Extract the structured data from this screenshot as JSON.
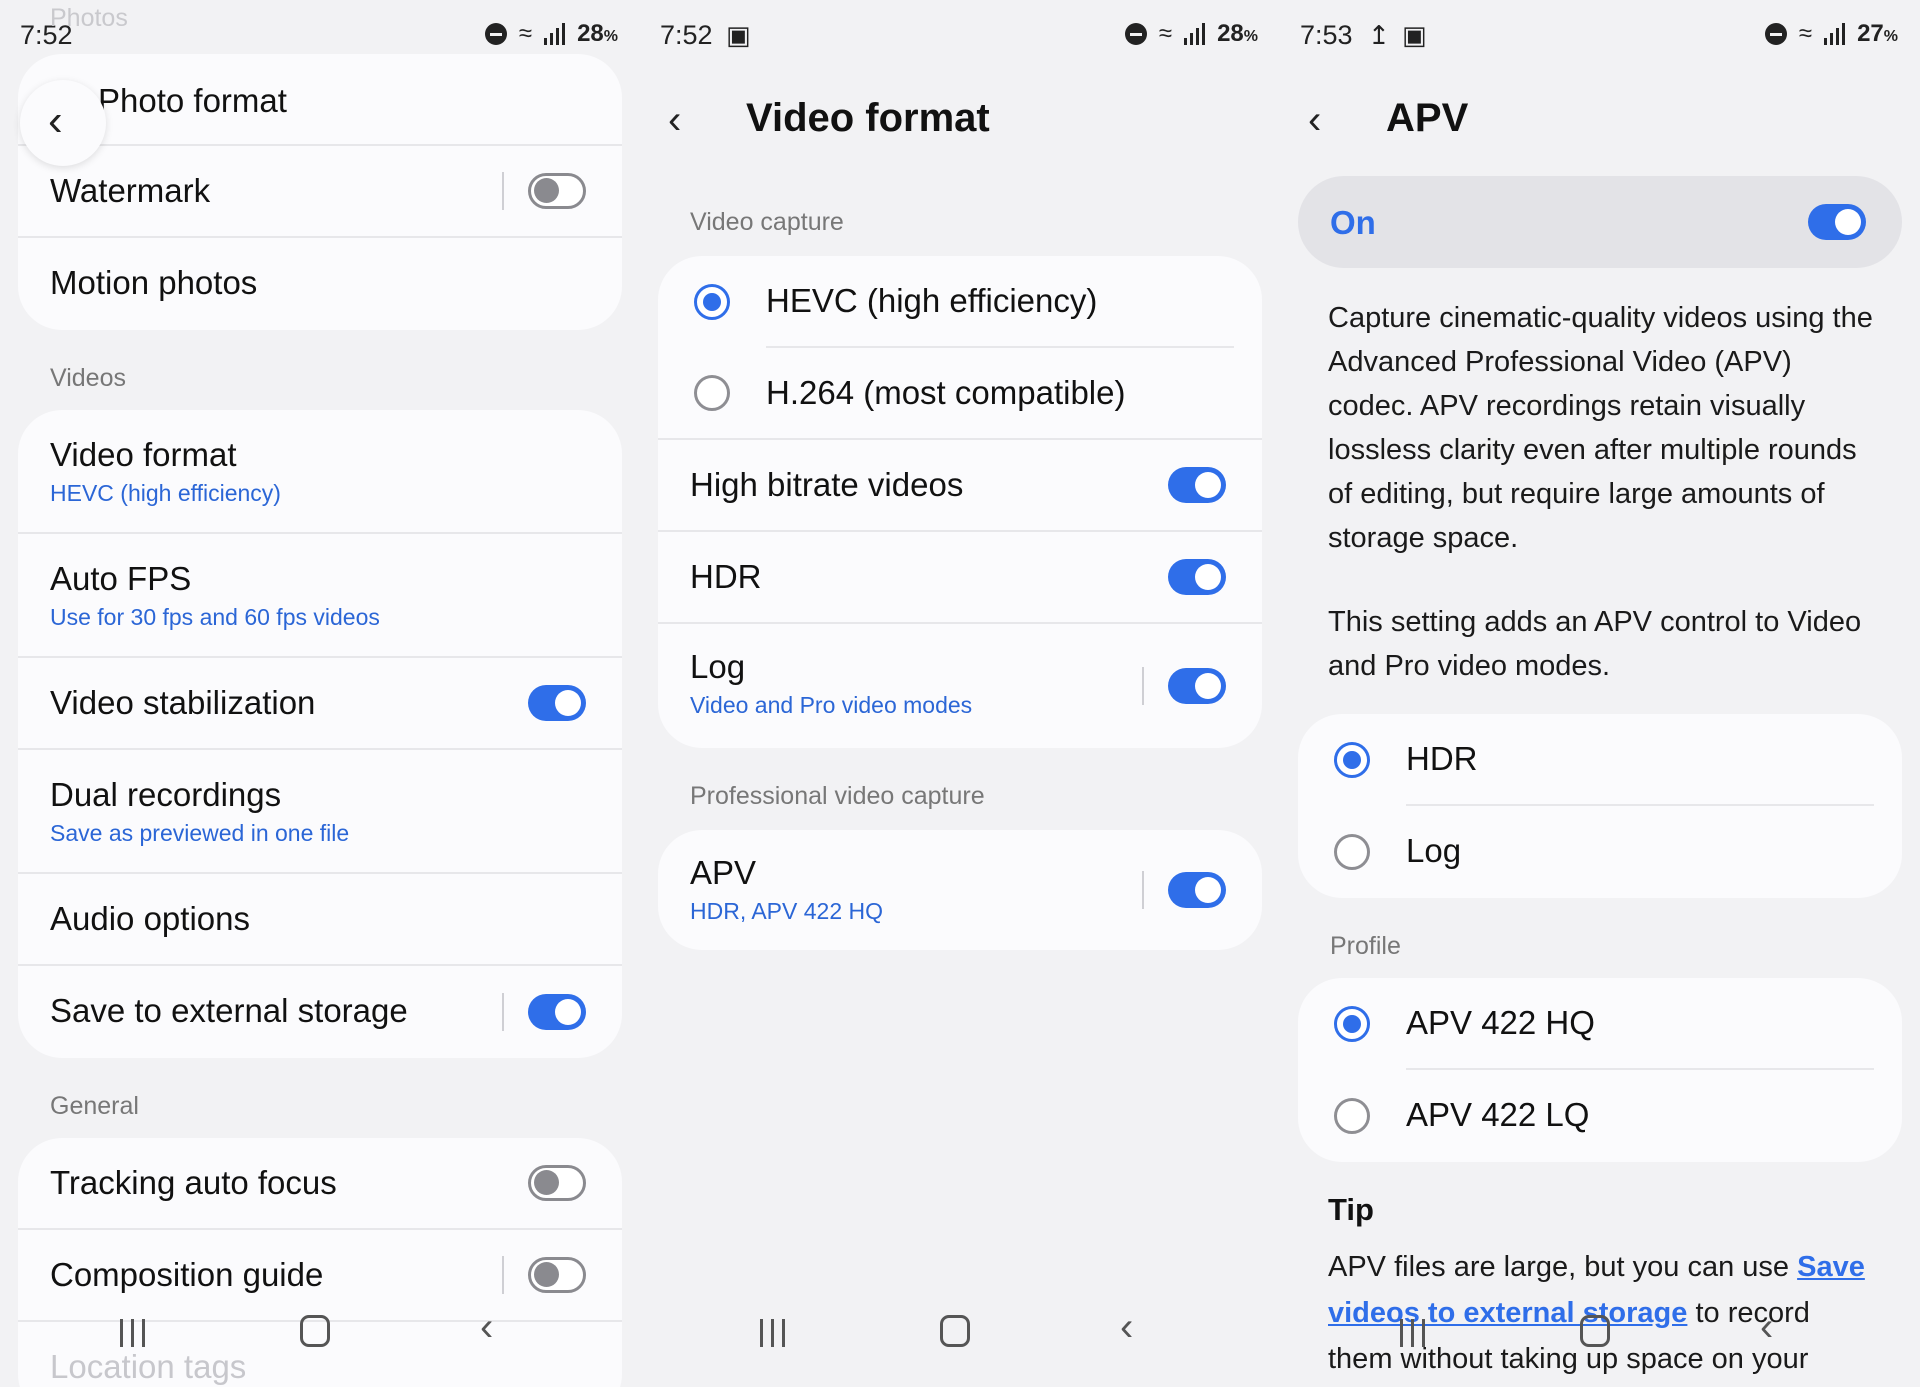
{
  "panel1": {
    "status": {
      "time": "7:52",
      "battery": "28",
      "pct": "%"
    },
    "top_label": "Photos",
    "photo_format": "Photo format",
    "watermark": "Watermark",
    "motion_photos": "Motion photos",
    "videos_header": "Videos",
    "video_format": {
      "title": "Video format",
      "value": "HEVC (high efficiency)"
    },
    "auto_fps": {
      "title": "Auto FPS",
      "value": "Use for 30 fps and 60 fps videos"
    },
    "video_stabilization": "Video stabilization",
    "dual_recordings": {
      "title": "Dual recordings",
      "value": "Save as previewed in one file"
    },
    "audio_options": "Audio options",
    "save_external": "Save to external storage",
    "general_header": "General",
    "tracking_af": "Tracking auto focus",
    "composition_guide": "Composition guide",
    "location_tags": "Location tags",
    "toggles": {
      "watermark": false,
      "video_stabilization": true,
      "save_external": true,
      "tracking_af": false,
      "composition_guide": false
    }
  },
  "panel2": {
    "status": {
      "time": "7:52",
      "battery": "28",
      "pct": "%"
    },
    "title": "Video format",
    "capture_header": "Video capture",
    "hevc": "HEVC (high efficiency)",
    "h264": "H.264 (most compatible)",
    "high_bitrate": "High bitrate videos",
    "hdr": "HDR",
    "log": {
      "title": "Log",
      "value": "Video and Pro video modes"
    },
    "pro_header": "Professional video capture",
    "apv": {
      "title": "APV",
      "value": "HDR, APV 422 HQ"
    },
    "selected_codec": "HEVC (high efficiency)",
    "toggles": {
      "high_bitrate": true,
      "hdr": true,
      "log": true,
      "apv": true
    }
  },
  "panel3": {
    "status": {
      "time": "7:53",
      "battery": "27",
      "pct": "%"
    },
    "title": "APV",
    "master_label": "On",
    "master_on": true,
    "desc1": "Capture cinematic-quality videos using the Advanced Professional Video (APV) codec. APV recordings retain visually lossless clarity even after multiple rounds of editing, but require large amounts of storage space.",
    "desc2": "This setting adds an APV control to Video and Pro video modes.",
    "mode_hdr": "HDR",
    "mode_log": "Log",
    "profile_header": "Profile",
    "profile_hq": "APV 422 HQ",
    "profile_lq": "APV 422 LQ",
    "tip_title": "Tip",
    "tip_pre": "APV files are large, but you can use ",
    "tip_link": "Save videos to external storage",
    "tip_post": " to record them without taking up space on your"
  },
  "colors": {
    "accent": "#2f6ee9",
    "background": "#f2f2f4",
    "card": "#fbfbfd"
  }
}
